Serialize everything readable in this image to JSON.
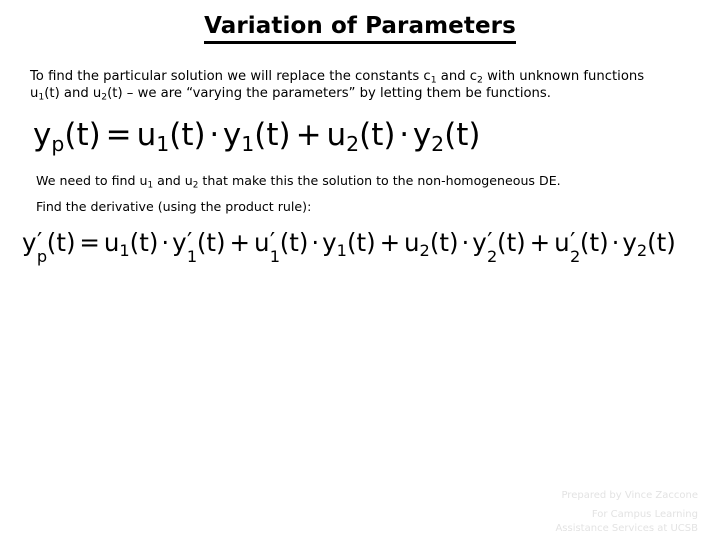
{
  "slide": {
    "title": "Variation of Parameters",
    "intro_paragraph": {
      "part1": "To find the particular solution we will replace the constants c",
      "sub1": "1",
      "part2": " and c",
      "sub2": "2",
      "part3": " with unknown functions u",
      "sub3": "1",
      "part4": "(t) and u",
      "sub4": "2",
      "part5": "(t) – we are “varying the parameters” by letting them be functions."
    },
    "need_line": {
      "part1": "We need to find u",
      "sub1": "1",
      "part2": " and u",
      "sub2": "2",
      "part3": " that make this the solution to the non-homogeneous DE."
    },
    "find_line": "Find the derivative (using the product rule):",
    "equation_1": {
      "plain": "yp(t) = u1(t) · y1(t) + u2(t) · y2(t)",
      "lhs_var": "y",
      "lhs_sub": "p",
      "lhs_arg": "(t)",
      "equals": "=",
      "t1_var": "u",
      "t1_sub": "1",
      "t1_arg": "(t)",
      "dot": "·",
      "t2_var": "y",
      "t2_sub": "1",
      "t2_arg": "(t)",
      "plus": "+",
      "t3_var": "u",
      "t3_sub": "2",
      "t3_arg": "(t)",
      "t4_var": "y",
      "t4_sub": "2",
      "t4_arg": "(t)"
    },
    "equation_2": {
      "plain": "y′p(t) = u1(t) · y′1(t) + u′1(t) · y1(t) + u2(t) · y′2(t) + u′2(t) · y2(t)",
      "prime": "′",
      "dot": "·",
      "plus": "+",
      "equals": "=",
      "lhs_var": "y",
      "lhs_sub": "p",
      "lhs_arg": "(t)",
      "a1_var": "u",
      "a1_sub": "1",
      "a1_arg": "(t)",
      "a2_var": "y",
      "a2_sub": "1",
      "a2_arg": "(t)",
      "b1_var": "u",
      "b1_sub": "1",
      "b1_arg": "(t)",
      "b2_var": "y",
      "b2_sub": "1",
      "b2_arg": "(t)",
      "c1_var": "u",
      "c1_sub": "2",
      "c1_arg": "(t)",
      "c2_var": "y",
      "c2_sub": "2",
      "c2_arg": "(t)",
      "d1_var": "u",
      "d1_sub": "2",
      "d1_arg": "(t)",
      "d2_var": "y",
      "d2_sub": "2",
      "d2_arg": "(t)"
    },
    "footer": {
      "line1": "Prepared by Vince Zaccone",
      "line2": "For Campus Learning",
      "line3": "Assistance Services at UCSB"
    },
    "colors": {
      "background": "#ffffff",
      "text": "#000000",
      "footer_text": "#e3e3e3"
    }
  }
}
